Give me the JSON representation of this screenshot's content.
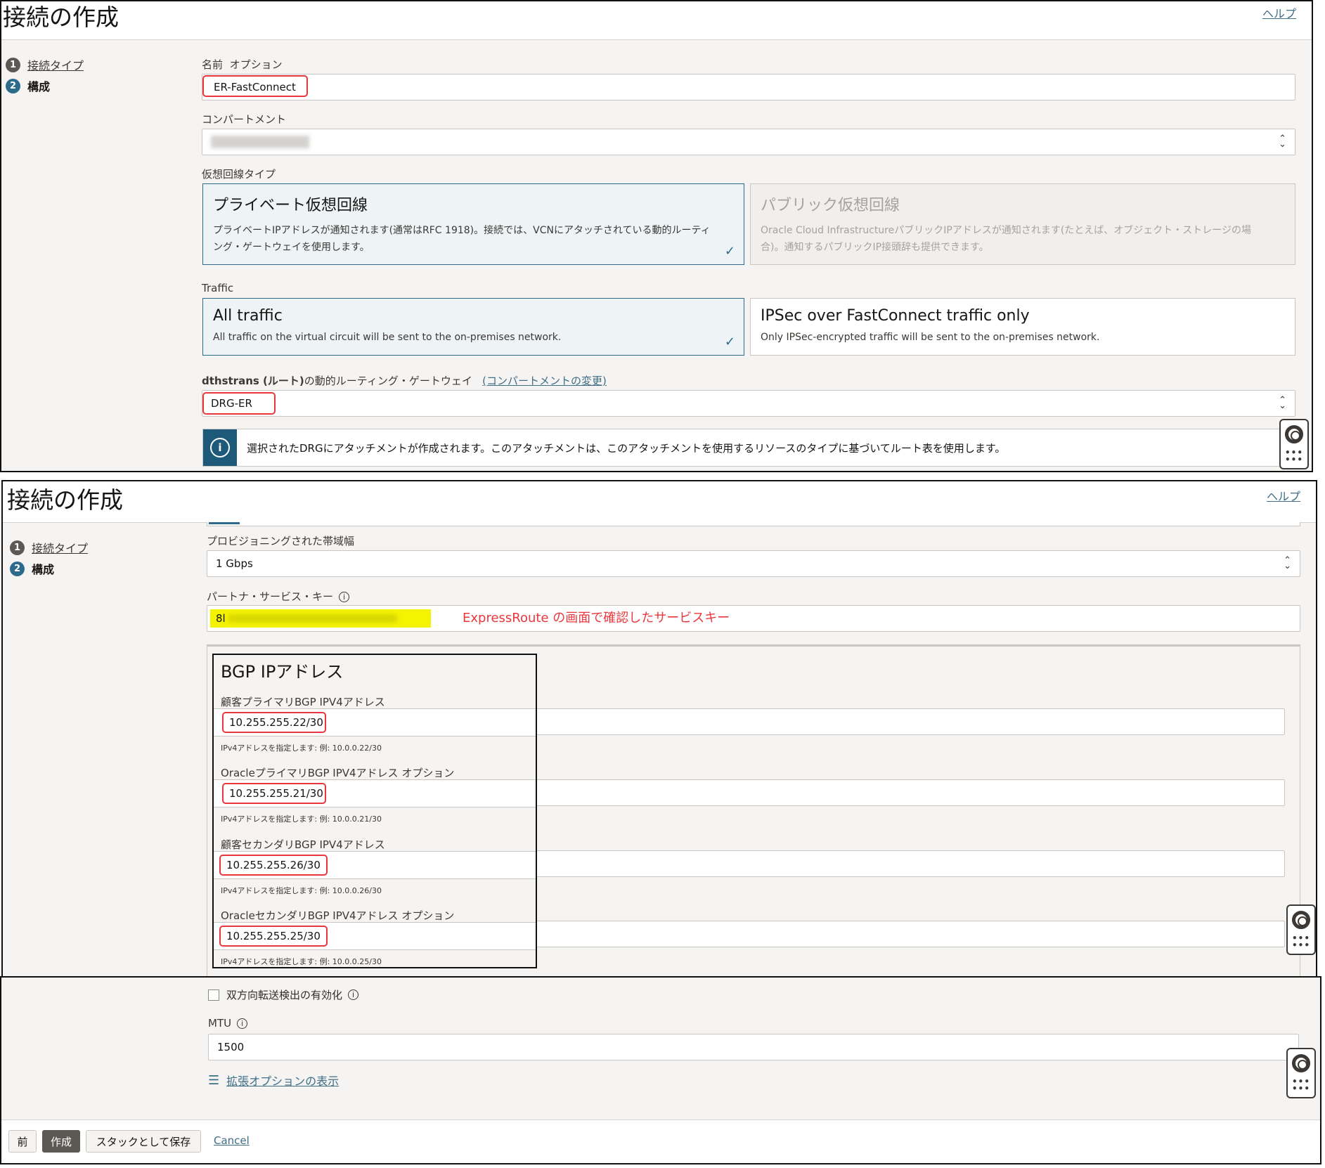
{
  "page": {
    "title": "接続の作成",
    "help_label": "ヘルプ",
    "steps": [
      {
        "num": "1",
        "label": "接続タイプ"
      },
      {
        "num": "2",
        "label": "構成"
      }
    ]
  },
  "form": {
    "name": {
      "label": "名前",
      "optional": "オプション",
      "value": "ER-FastConnect"
    },
    "compartment": {
      "label": "コンパートメント"
    },
    "virtual_circuit_type": {
      "label": "仮想回線タイプ",
      "options": [
        {
          "title": "プライベート仮想回線",
          "desc": "プライベートIPアドレスが通知されます(通常はRFC 1918)。接続では、VCNにアタッチされている動的ルーティング・ゲートウェイを使用します。",
          "selected": true
        },
        {
          "title": "パブリック仮想回線",
          "desc": "Oracle Cloud InfrastructureパブリックIPアドレスが通知されます(たとえば、オブジェクト・ストレージの場合)。通知するパブリックIP接頭辞も提供できます。",
          "selected": false
        }
      ]
    },
    "traffic": {
      "label": "Traffic",
      "options": [
        {
          "title": "All traffic",
          "desc": "All traffic on the virtual circuit will be sent to the on-premises network.",
          "selected": true
        },
        {
          "title": "IPSec over FastConnect traffic only",
          "desc": "Only IPSec-encrypted traffic will be sent to the on-premises network.",
          "selected": false
        }
      ]
    },
    "drg": {
      "label_bold": "dthstrans (ルート)",
      "label_rest": "の動的ルーティング・ゲートウェイ",
      "change_link": "(コンパートメントの変更)",
      "value": "DRG-ER"
    },
    "info_message": "選択されたDRGにアタッチメントが作成されます。このアタッチメントは、このアタッチメントを使用するリソースのタイプに基づいてルート表を使用します。",
    "bandwidth": {
      "label": "プロビジョニングされた帯域幅",
      "value": "1 Gbps"
    },
    "service_key": {
      "label": "パートナ・サービス・キー",
      "value_prefix": "8l",
      "annotation": "ExpressRoute の画面で確認したサービスキー"
    },
    "bgp": {
      "title": "BGP IPアドレス",
      "fields": [
        {
          "label": "顧客プライマリBGP IPV4アドレス",
          "value": "10.255.255.22/30",
          "hint": "IPv4アドレスを指定します: 例: 10.0.0.22/30"
        },
        {
          "label": "OracleプライマリBGP IPV4アドレス オプション",
          "value": "10.255.255.21/30",
          "hint": "IPv4アドレスを指定します: 例: 10.0.0.21/30"
        },
        {
          "label": "顧客セカンダリBGP IPV4アドレス",
          "value": "10.255.255.26/30",
          "hint": "IPv4アドレスを指定します: 例: 10.0.0.26/30"
        },
        {
          "label": "OracleセカンダリBGP IPV4アドレス オプション",
          "value": "10.255.255.25/30",
          "hint": "IPv4アドレスを指定します: 例: 10.0.0.25/30"
        }
      ]
    },
    "bfd": {
      "label": "双方向転送検出の有効化"
    },
    "mtu": {
      "label": "MTU",
      "value": "1500"
    },
    "advanced_link": "拡張オプションの表示"
  },
  "footer": {
    "prev": "前",
    "create": "作成",
    "save_stack": "スタックとして保存",
    "cancel": "Cancel"
  },
  "colors": {
    "accent": "#2d6b8c",
    "annotation_red": "#e8383d",
    "highlight_yellow": "#f4f400"
  }
}
